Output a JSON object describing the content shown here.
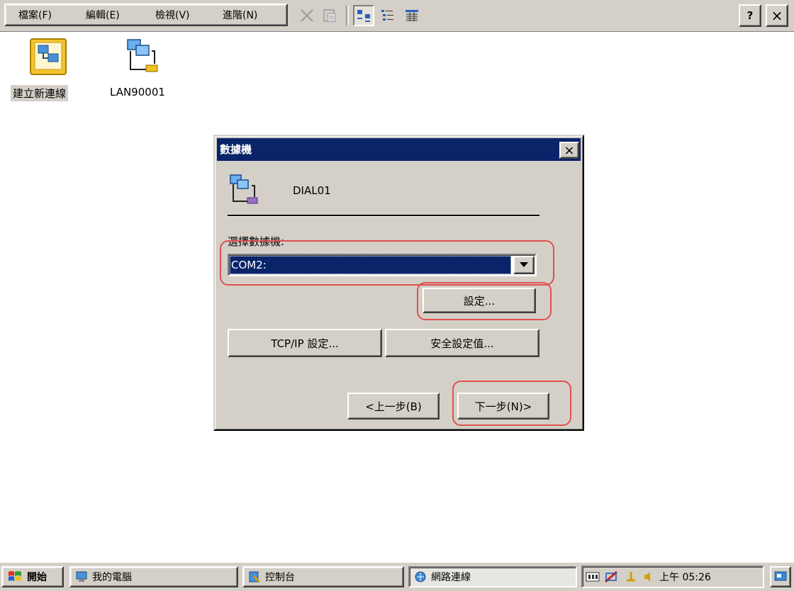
{
  "menubar": {
    "items": [
      "檔案(F)",
      "編輯(E)",
      "檢視(V)",
      "進階(N)"
    ]
  },
  "titlebar_buttons": {
    "help": "?",
    "close": "×"
  },
  "desktop": {
    "icons": [
      {
        "label": "建立新連線",
        "icon": "make-new-connection-icon"
      },
      {
        "label": "LAN90001",
        "icon": "lan-connection-icon"
      }
    ]
  },
  "dialog": {
    "title": "數據機",
    "close": "×",
    "connection_name": "DIAL01",
    "select_label": "選擇數據機:",
    "selected_modem": "COM2:",
    "configure_button": "設定...",
    "tcpip_button": "TCP/IP 設定...",
    "security_button": "安全設定值...",
    "back_button": "<上一步(B)",
    "next_button": "下一步(N)>"
  },
  "taskbar": {
    "start": "開始",
    "tasks": [
      "我的電腦",
      "控制台",
      "網路連線"
    ],
    "clock": "上午 05:26"
  },
  "colors": {
    "titlebar": "#0a246a",
    "highlight": "#0a246a",
    "face": "#d4d0c8",
    "annotation": "#e05050"
  }
}
